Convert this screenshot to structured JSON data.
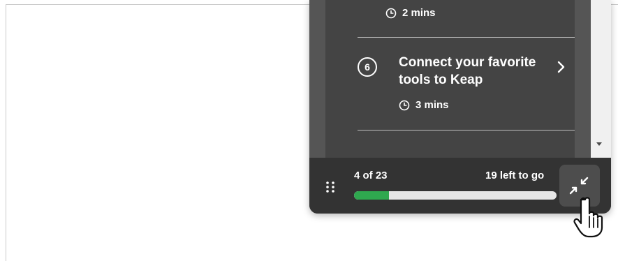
{
  "steps": [
    {
      "duration": "2 mins"
    },
    {
      "number": "6",
      "title": "Connect your favorite tools to Keap",
      "duration": "3 mins"
    }
  ],
  "progress": {
    "current_label": "4 of 23",
    "remaining_label": "19 left to go",
    "completed": 4,
    "total": 23,
    "fraction": 0.174
  },
  "colors": {
    "panel": "#3c3c3c",
    "progress_fill": "#2fa84f",
    "progress_track": "#e6e6e6"
  },
  "icons": {
    "clock": "clock-icon",
    "chevron": "chevron-right-icon",
    "drag": "drag-handle-icon",
    "collapse": "collapse-arrows-icon",
    "cursor": "hand-pointer-cursor"
  }
}
